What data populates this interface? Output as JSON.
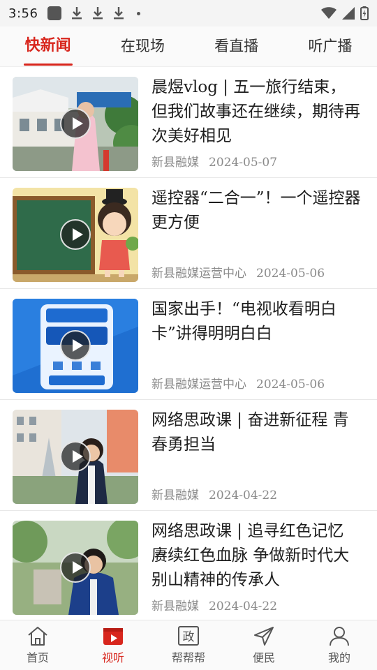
{
  "status_bar": {
    "time": "3:56",
    "icons": [
      "app-icon",
      "download-icon",
      "download-icon",
      "download-icon",
      "notification-dot-icon",
      "wifi-icon",
      "signal-icon",
      "battery-icon"
    ]
  },
  "tabs": [
    {
      "label": "快新闻",
      "active": true
    },
    {
      "label": "在现场",
      "active": false
    },
    {
      "label": "看直播",
      "active": false
    },
    {
      "label": "听广播",
      "active": false
    }
  ],
  "news": [
    {
      "title": "晨煜vlog | 五一旅行结束，但我们故事还在继续，期待再次美好相见",
      "source": "新县融媒",
      "date": "2024-05-07"
    },
    {
      "title": "遥控器“二合一”！一个遥控器更方便",
      "source": "新县融媒运营中心",
      "date": "2024-05-06"
    },
    {
      "title": "国家出手！“电视收看明白卡”讲得明明白白",
      "source": "新县融媒运营中心",
      "date": "2024-05-06"
    },
    {
      "title": "网络思政课 | 奋进新征程 青春勇担当",
      "source": "新县融媒",
      "date": "2024-04-22"
    },
    {
      "title": "网络思政课 | 追寻红色记忆 赓续红色血脉 争做新时代大别山精神的传承人",
      "source": "新县融媒",
      "date": "2024-04-22"
    }
  ],
  "bottom_nav": [
    {
      "label": "首页",
      "icon": "home-icon",
      "active": false
    },
    {
      "label": "视听",
      "icon": "video-play-icon",
      "active": true
    },
    {
      "label": "帮帮帮",
      "icon": "government-icon",
      "active": false
    },
    {
      "label": "便民",
      "icon": "send-icon",
      "active": false
    },
    {
      "label": "我的",
      "icon": "user-icon",
      "active": false
    }
  ],
  "colors": {
    "accent": "#d8261d",
    "meta_text": "#8a8a8a",
    "title_text": "#1e1e1e"
  }
}
